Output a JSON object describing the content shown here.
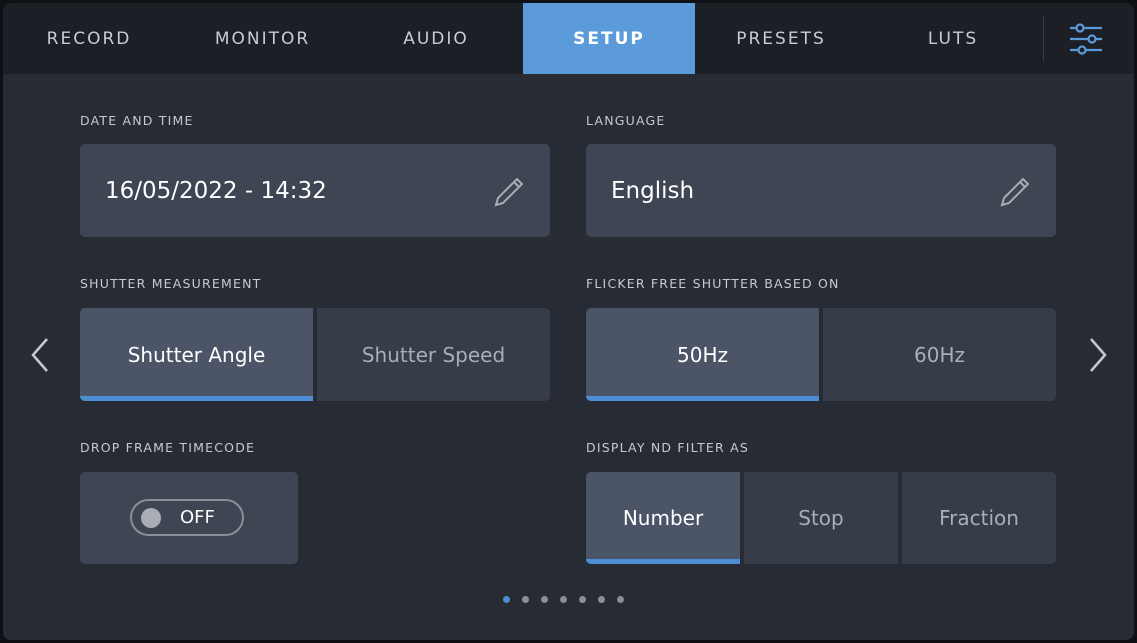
{
  "tabs": [
    {
      "label": "RECORD",
      "active": false
    },
    {
      "label": "MONITOR",
      "active": false
    },
    {
      "label": "AUDIO",
      "active": false
    },
    {
      "label": "SETUP",
      "active": true
    },
    {
      "label": "PRESETS",
      "active": false
    },
    {
      "label": "LUTS",
      "active": false
    }
  ],
  "settings_icon": "sliders-icon",
  "date_time": {
    "label": "DATE AND TIME",
    "value": "16/05/2022 - 14:32",
    "edit_icon": "pencil-icon"
  },
  "language": {
    "label": "LANGUAGE",
    "value": "English",
    "edit_icon": "pencil-icon"
  },
  "shutter_measurement": {
    "label": "SHUTTER MEASUREMENT",
    "options": [
      "Shutter Angle",
      "Shutter Speed"
    ],
    "selected": "Shutter Angle"
  },
  "flicker_free": {
    "label": "FLICKER FREE SHUTTER BASED ON",
    "options": [
      "50Hz",
      "60Hz"
    ],
    "selected": "50Hz"
  },
  "drop_frame": {
    "label": "DROP FRAME TIMECODE",
    "state": "OFF"
  },
  "nd_filter": {
    "label": "DISPLAY ND FILTER AS",
    "options": [
      "Number",
      "Stop",
      "Fraction"
    ],
    "selected": "Number"
  },
  "pager": {
    "pages": 7,
    "current": 1
  },
  "colors": {
    "accent": "#5c9bd9",
    "selected_bar": "#4c8fd4",
    "card": "#3e4553",
    "background": "#272b33"
  }
}
